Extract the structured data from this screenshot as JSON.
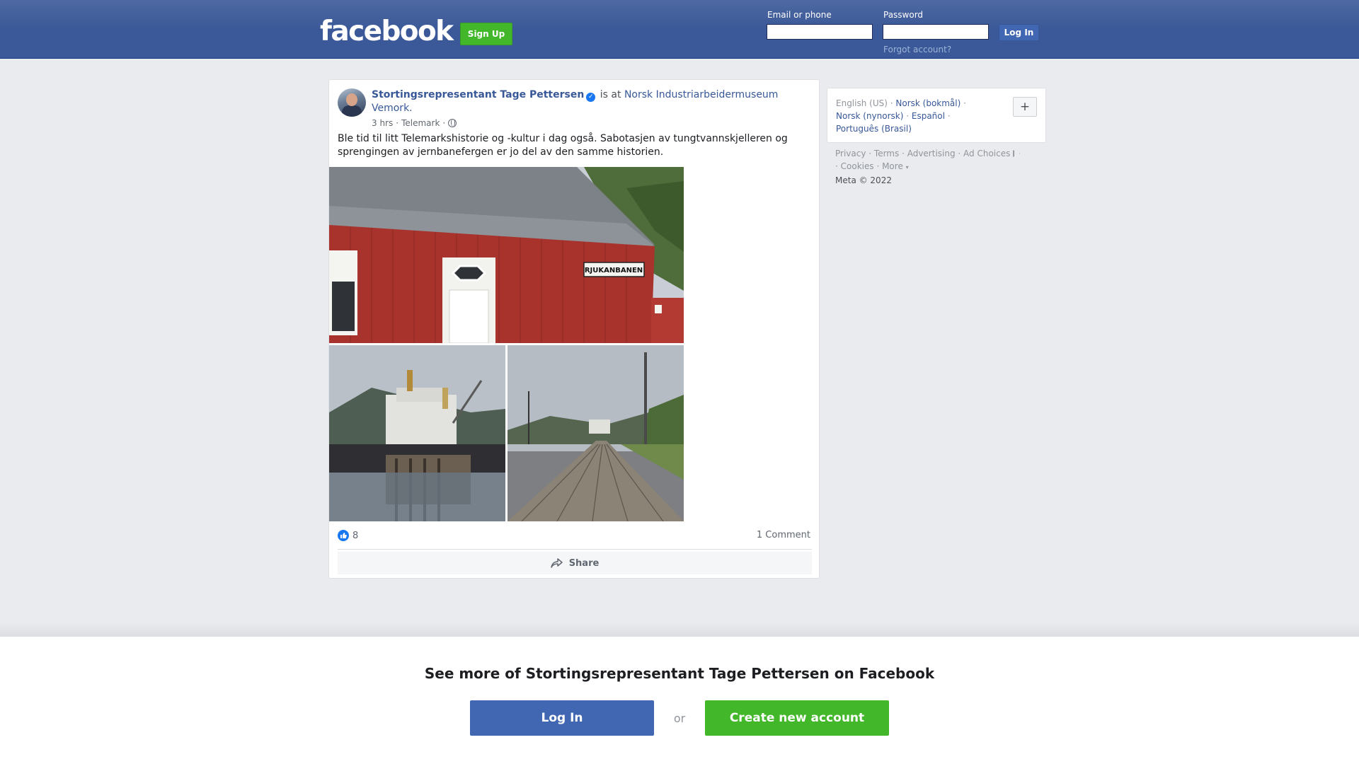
{
  "header": {
    "logo": "facebook",
    "signup_label": "Sign Up",
    "email_label": "Email or phone",
    "password_label": "Password",
    "login_label": "Log In",
    "forgot_label": "Forgot account?"
  },
  "post": {
    "author": "Stortingsrepresentant Tage Pettersen",
    "verified": true,
    "is_at": "is at",
    "location": "Norsk Industriarbeidermuseum Vemork",
    "location_end": ".",
    "time": "3 hrs",
    "place": "Telemark",
    "separator": "·",
    "privacy_icon": "globe-icon",
    "text": "Ble tid til litt Telemarkshistorie og -kultur i dag også. Sabotasjen av tungtvannskjelleren og sprengingen av jernbanefergen er jo del av den samme historien.",
    "photo_sign": "RJUKANBANEN",
    "like_count": "8",
    "comments": "1 Comment",
    "share_label": "Share"
  },
  "languages": {
    "current": "English (US)",
    "options": [
      "Norsk (bokmål)",
      "Norsk (nynorsk)",
      "Español",
      "Português (Brasil)"
    ],
    "more_icon": "plus-icon"
  },
  "footer": {
    "links": [
      "Privacy",
      "Terms",
      "Advertising",
      "Ad Choices",
      "Cookies",
      "More"
    ],
    "copyright": "Meta © 2022"
  },
  "bottom": {
    "title": "See more of Stortingsrepresentant Tage Pettersen on Facebook",
    "login_label": "Log In",
    "or_label": "or",
    "create_label": "Create new account"
  },
  "colors": {
    "brand_blue": "#3b5998",
    "login_blue": "#4267b2",
    "signup_green": "#42b72a",
    "link_blue": "#385898"
  }
}
